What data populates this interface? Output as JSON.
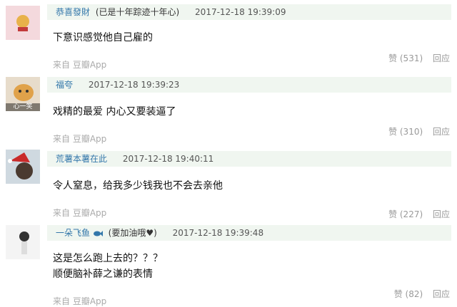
{
  "comments": [
    {
      "author": "恭喜發財",
      "author_extra": "(已是十年踪迹十年心)",
      "time": "2017-12-18 19:39:09",
      "lines": [
        "下意识感觉他自己雇的"
      ],
      "source": "来自 豆瓣App",
      "like": "赞 (531)",
      "reply": "回应"
    },
    {
      "author": "福夸",
      "author_extra": "",
      "time": "2017-12-18 19:39:23",
      "lines": [
        "戏精的最爱 内心又要装逼了"
      ],
      "source": "来自 豆瓣App",
      "like": "赞 (310)",
      "reply": "回应",
      "avatar_caption": "心一笑"
    },
    {
      "author": "荒薯本薯在此",
      "author_extra": "",
      "time": "2017-12-18 19:40:11",
      "lines": [
        "令人窒息，给我多少钱我也不会去亲他"
      ],
      "source": "来自 豆瓣App",
      "like": "赞 (227)",
      "reply": "回应"
    },
    {
      "author": "一朵飞鱼",
      "author_extra": "(要加油哦♥)",
      "time": "2017-12-18 19:39:48",
      "lines": [
        "这是怎么跑上去的？？？",
        "顺便脑补薛之谦的表情"
      ],
      "source": "来自 豆瓣App",
      "like": "赞 (82)",
      "reply": "回应"
    }
  ],
  "colors": {
    "header_bg": "#f0f6f0",
    "author": "#3377aa",
    "meta": "#999999"
  }
}
